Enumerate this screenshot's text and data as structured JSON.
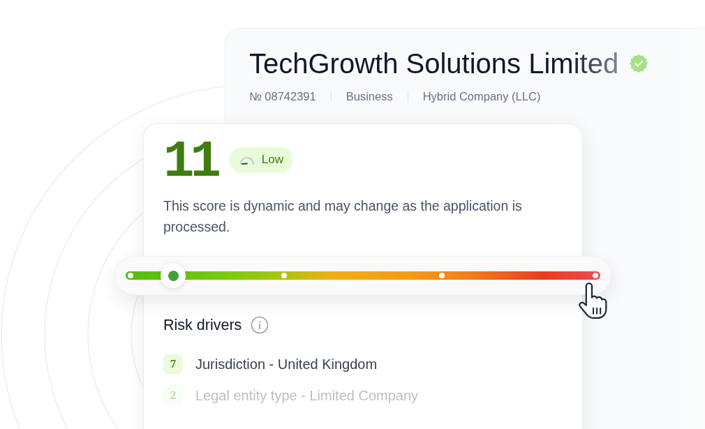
{
  "company": {
    "name": "TechGrowth Solutions Limited",
    "verified": true,
    "meta": [
      "№ 08742391",
      "Business",
      "Hybrid Company (LLC)"
    ]
  },
  "score": {
    "value": "11",
    "rating": "Low",
    "note": "This score is dynamic and may change as the application is processed.",
    "scale": {
      "level": 0.1
    }
  },
  "risk_drivers": {
    "title": "Risk drivers",
    "items": [
      {
        "points": "7",
        "text": "Jurisdiction - United Kingdom"
      },
      {
        "points": "2",
        "text": "Legal entity type - Limited Company"
      }
    ]
  }
}
